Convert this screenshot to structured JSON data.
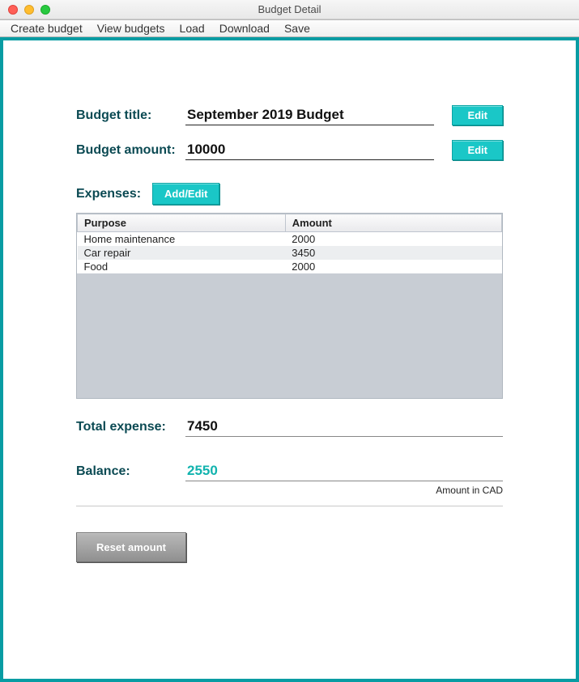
{
  "window": {
    "title": "Budget Detail"
  },
  "menu": {
    "create": "Create budget",
    "view": "View budgets",
    "load": "Load",
    "download": "Download",
    "save": "Save"
  },
  "labels": {
    "budget_title": "Budget title:",
    "budget_amount": "Budget amount:",
    "expenses": "Expenses:",
    "total_expense": "Total expense:",
    "balance": "Balance:",
    "currency_note": "Amount in CAD"
  },
  "buttons": {
    "edit": "Edit",
    "add_edit": "Add/Edit",
    "reset": "Reset amount"
  },
  "fields": {
    "budget_title": "September 2019 Budget",
    "budget_amount": "10000",
    "total_expense": "7450",
    "balance": "2550"
  },
  "table": {
    "headers": {
      "purpose": "Purpose",
      "amount": "Amount"
    },
    "rows": [
      {
        "purpose": "Home maintenance",
        "amount": "2000"
      },
      {
        "purpose": "Car repair",
        "amount": "3450"
      },
      {
        "purpose": "Food",
        "amount": "2000"
      }
    ]
  }
}
